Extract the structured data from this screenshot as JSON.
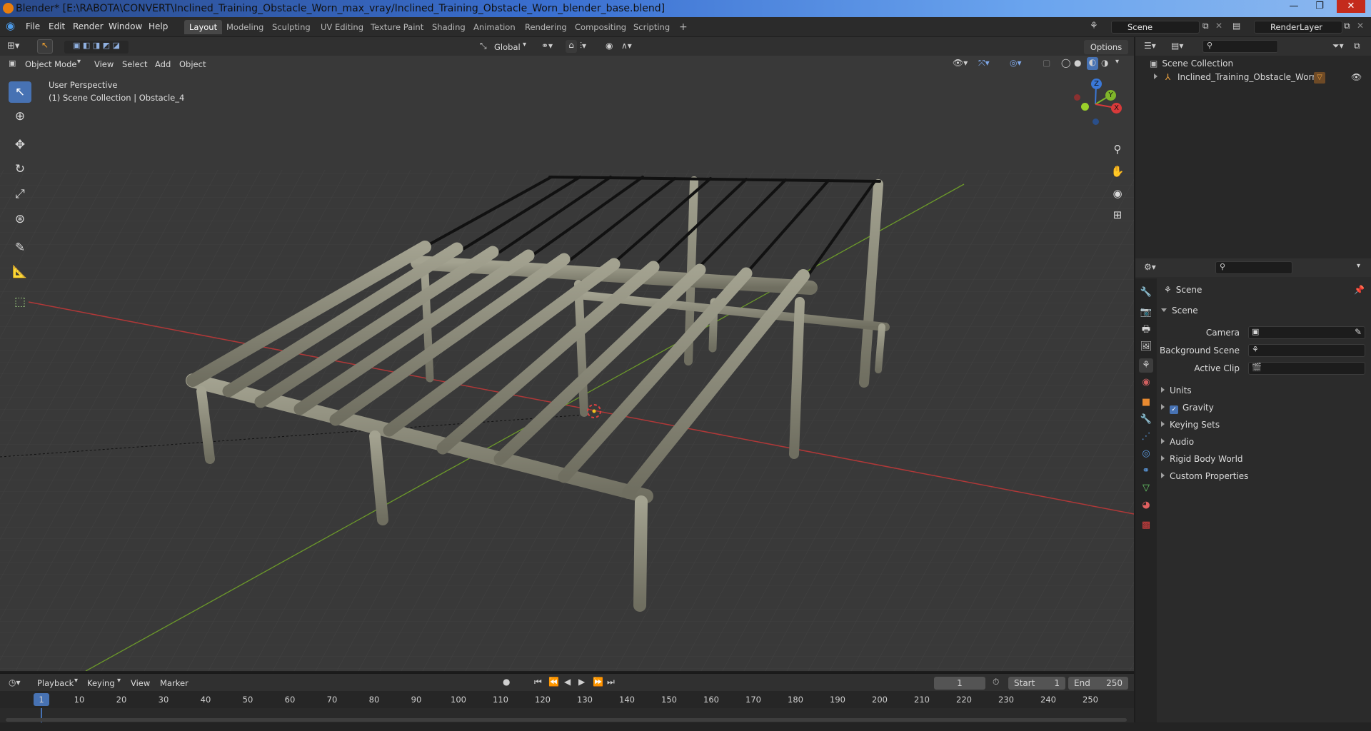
{
  "window": {
    "title": "Blender* [E:\\RABOTA\\CONVERT\\Inclined_Training_Obstacle_Worn_max_vray/Inclined_Training_Obstacle_Worn_blender_base.blend]",
    "minimize": "—",
    "maximize": "❐",
    "close": "✕"
  },
  "menubar": [
    "File",
    "Edit",
    "Render",
    "Window",
    "Help"
  ],
  "workspaces": [
    "Layout",
    "Modeling",
    "Sculpting",
    "UV Editing",
    "Texture Paint",
    "Shading",
    "Animation",
    "Rendering",
    "Compositing",
    "Scripting"
  ],
  "active_workspace": "Layout",
  "scene_selector": "Scene",
  "view_layer_selector": "RenderLayer",
  "viewport_header": {
    "mode": "Object Mode",
    "menus": [
      "View",
      "Select",
      "Add",
      "Object"
    ],
    "transform_orientation": "Global",
    "options": "Options"
  },
  "viewport": {
    "perspective": "User Perspective",
    "collection_info": "(1) Scene Collection | Obstacle_4",
    "gizmo": {
      "z": "Z",
      "y": "Y",
      "x": "X"
    }
  },
  "outliner": {
    "root": "Scene Collection",
    "items": [
      {
        "label": "Inclined_Training_Obstacle_Worn"
      }
    ]
  },
  "properties": {
    "context": "Scene",
    "panel": "Scene",
    "fields": [
      {
        "label": "Camera",
        "value": ""
      },
      {
        "label": "Background Scene",
        "value": ""
      },
      {
        "label": "Active Clip",
        "value": ""
      }
    ],
    "sections": [
      "Units",
      "Gravity",
      "Keying Sets",
      "Audio",
      "Rigid Body World",
      "Custom Properties"
    ],
    "gravity_checked": true
  },
  "timeline": {
    "menus": [
      "Playback",
      "Keying",
      "View",
      "Marker"
    ],
    "current_frame": "1",
    "start_label": "Start",
    "start": "1",
    "end_label": "End",
    "end": "250",
    "ruler": [
      "1",
      "10",
      "20",
      "30",
      "40",
      "50",
      "60",
      "70",
      "80",
      "90",
      "100",
      "110",
      "120",
      "130",
      "140",
      "150",
      "160",
      "170",
      "180",
      "190",
      "200",
      "210",
      "220",
      "230",
      "240",
      "250"
    ]
  },
  "colors": {
    "accent": "#4772b3",
    "grid_x": "#b03838",
    "grid_y": "#6c9a2a",
    "wood": "#8e8d7c"
  }
}
